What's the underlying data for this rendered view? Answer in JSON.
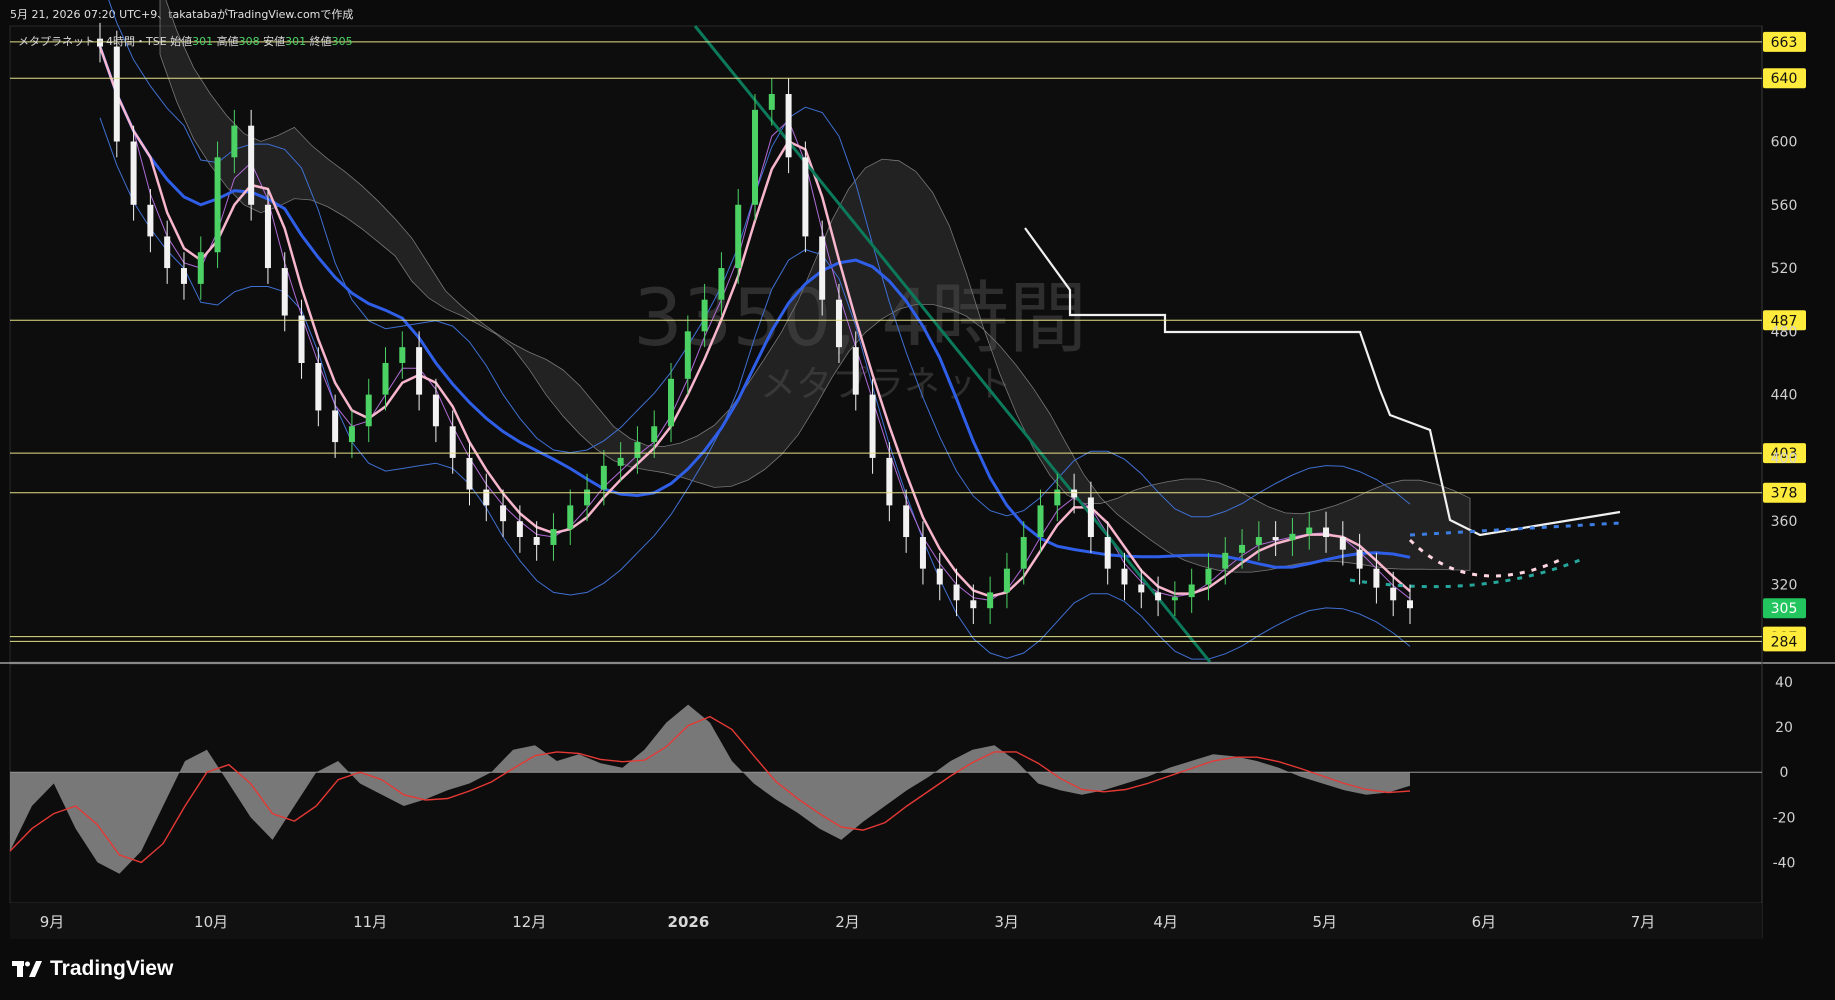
{
  "header": {
    "caption": "5月 21, 2026 07:20 UTC+9、takatabaがTradingView.comで作成"
  },
  "legend": {
    "symbol": "メタプラネット・4時間・TSE",
    "open_label": "始値",
    "open_value": "301",
    "high_label": "高値",
    "high_value": "308",
    "low_label": "安値",
    "low_value": "301",
    "close_label": "終値",
    "close_value": "305"
  },
  "watermark": {
    "ticker": "3350, 4時間",
    "name": "メタプラネット"
  },
  "brand": {
    "name": "TradingView"
  },
  "colors": {
    "background": "#0b0b0b",
    "up": "#4cd264",
    "down": "#f2f2f2",
    "level_line": "#e6e088",
    "level_badge": "#ffeb3b",
    "price_badge": "#22c55e",
    "sma_fast": "#f7b6cd",
    "sma_slow": "#2f5fe8",
    "cloud": "#4a4a4a",
    "trend": "#0c7a5a",
    "osc_fill": "#8c8c8c",
    "osc_signal": "#e53935"
  },
  "chart_data": {
    "type": "line",
    "title": "",
    "price_axis": {
      "range": [
        271,
        673
      ],
      "ticks": [
        320,
        360,
        400,
        440,
        480,
        520,
        560,
        600
      ]
    },
    "x_axis": {
      "labels": [
        "9月",
        "10月",
        "11月",
        "12月",
        "2026",
        "2月",
        "3月",
        "4月",
        "5月",
        "6月",
        "7月"
      ]
    },
    "levels": [
      663,
      640,
      487,
      403,
      378,
      287,
      284
    ],
    "last_price": 305,
    "price_series": {
      "name": "",
      "values": [
        660,
        600,
        560,
        540,
        520,
        510,
        530,
        590,
        610,
        560,
        520,
        490,
        460,
        430,
        410,
        420,
        440,
        460,
        470,
        440,
        420,
        400,
        380,
        370,
        360,
        350,
        345,
        355,
        370,
        380,
        395,
        400,
        410,
        420,
        450,
        480,
        500,
        520,
        560,
        620,
        630,
        590,
        540,
        500,
        470,
        440,
        400,
        370,
        350,
        330,
        320,
        310,
        305,
        315,
        330,
        350,
        370,
        380,
        375,
        350,
        330,
        320,
        315,
        310,
        312,
        320,
        330,
        340,
        345,
        350,
        348,
        352,
        356,
        350,
        342,
        330,
        318,
        310,
        305
      ]
    },
    "oscillator": {
      "axis_range": [
        -58,
        48
      ],
      "ticks": [
        40,
        20,
        0,
        -20,
        -40
      ],
      "values": [
        -35,
        -15,
        -5,
        -25,
        -40,
        -45,
        -35,
        -15,
        5,
        10,
        -5,
        -20,
        -30,
        -15,
        0,
        5,
        -5,
        -10,
        -15,
        -12,
        -8,
        -5,
        0,
        10,
        12,
        5,
        8,
        4,
        2,
        10,
        22,
        30,
        22,
        5,
        -5,
        -12,
        -18,
        -25,
        -30,
        -22,
        -15,
        -8,
        -2,
        5,
        10,
        12,
        5,
        -5,
        -8,
        -10,
        -8,
        -5,
        -2,
        2,
        5,
        8,
        7,
        5,
        2,
        -2,
        -5,
        -8,
        -10,
        -9,
        -6
      ]
    }
  }
}
